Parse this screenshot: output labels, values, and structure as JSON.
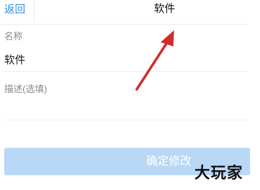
{
  "header": {
    "back_label": "返回",
    "title": "软件"
  },
  "form": {
    "name_label": "名称",
    "name_value": "软件",
    "description_label": "描述(选填)",
    "description_value": ""
  },
  "actions": {
    "confirm_label": "确定修改"
  },
  "watermark": {
    "logo_text": "大玩家"
  },
  "colors": {
    "accent": "#2f8fe8",
    "button_disabled": "#b9d8f6",
    "annotation_arrow": "#d42a2a"
  }
}
